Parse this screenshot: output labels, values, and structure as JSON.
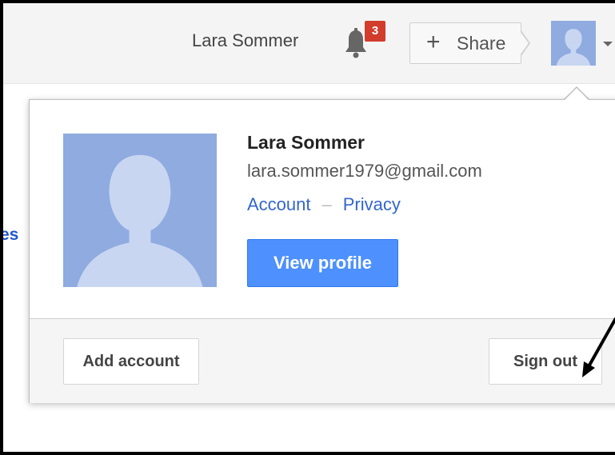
{
  "header": {
    "user_name": "Lara Sommer",
    "notifications_count": "3",
    "share": {
      "plus": "+",
      "label": "Share"
    }
  },
  "background_snippet": "es",
  "account_popup": {
    "name": "Lara Sommer",
    "email": "lara.sommer1979@gmail.com",
    "links": {
      "account": "Account",
      "separator": "–",
      "privacy": "Privacy"
    },
    "view_profile_label": "View profile",
    "footer": {
      "add_account_label": "Add account",
      "sign_out_label": "Sign out"
    }
  },
  "colors": {
    "link": "#3366cc",
    "primary_button": "#4d90fe",
    "badge": "#d23c2c",
    "avatar_bg": "#8fabe0",
    "avatar_silhouette": "#c8d6f2"
  },
  "icons": {
    "bell": "bell-icon",
    "avatar_placeholder": "person-silhouette-icon",
    "dropdown_caret": "caret-down-icon",
    "annotation_arrow": "arrow-icon"
  }
}
